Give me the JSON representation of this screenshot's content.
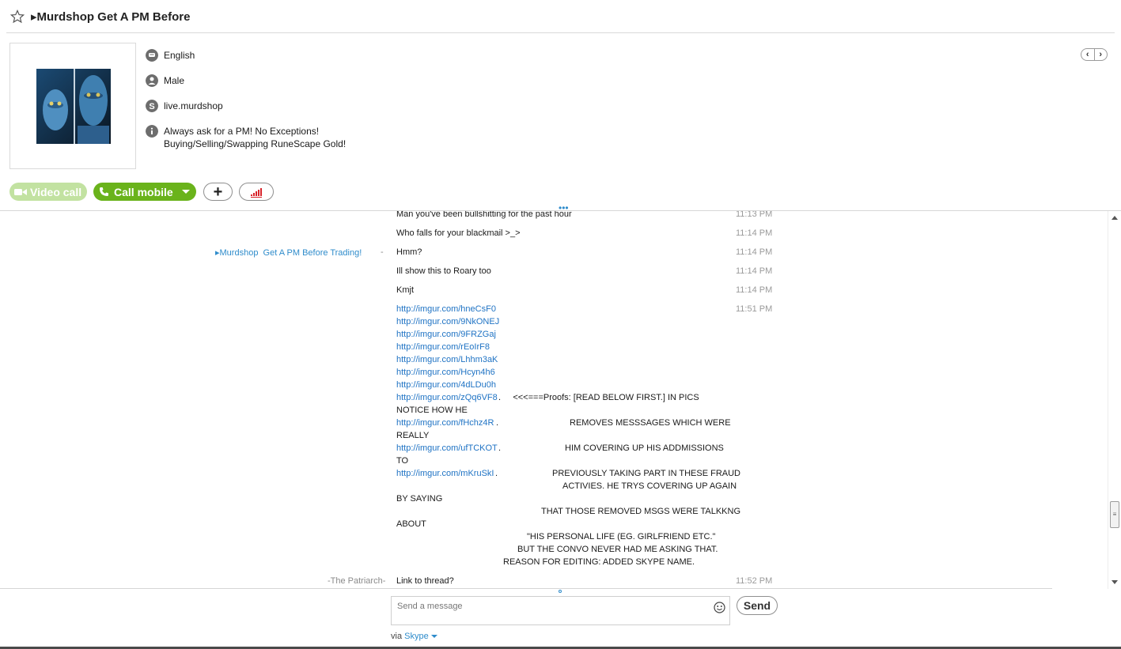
{
  "header": {
    "title": "▸Murdshop  Get A PM Before"
  },
  "profile": {
    "language": "English",
    "gender": "Male",
    "skype_name": "live.murdshop",
    "mood_line1": "Always ask for a PM! No Exceptions!",
    "mood_line2": "Buying/Selling/Swapping RuneScape Gold!"
  },
  "nav": {
    "prev": "‹",
    "next": "›"
  },
  "actions": {
    "video_call": "Video call",
    "call_mobile": "Call mobile",
    "add": "+"
  },
  "chat": {
    "messages": [
      {
        "text": "Man you've been bullshitting for the past hour",
        "time": "11:13 PM"
      },
      {
        "text": "Who falls for your blackmail >_>",
        "time": "11:14 PM"
      },
      {
        "sender": "▸Murdshop  Get A PM Before Trading!",
        "sender_dash": "-",
        "text": "Hmm?",
        "time": "11:14 PM"
      },
      {
        "text": "Ill show this to Roary too",
        "time": "11:14 PM"
      },
      {
        "text": "Kmjt",
        "time": "11:14 PM"
      }
    ],
    "long_message_time": "11:51 PM",
    "links": [
      "http://imgur.com/hneCsF0",
      "http://imgur.com/9NkONEJ",
      "http://imgur.com/9FRZGaj",
      "http://imgur.com/rEoIrF8",
      "http://imgur.com/Lhhm3aK",
      "http://imgur.com/Hcyn4h6",
      "http://imgur.com/4dLDu0h"
    ],
    "proof_link": "http://imgur.com/zQq6VF8",
    "proof_text": ".     <<<===Proofs: [READ BELOW FIRST.] IN PICS",
    "notice": "NOTICE HOW HE",
    "link2": "http://imgur.com/fHchz4R",
    "link2_text": "REMOVES MESSSAGES WHICH WERE",
    "really": "REALLY",
    "link3": "http://imgur.com/ufTCKOT",
    "link3_text": "HIM COVERING UP HIS ADDMISSIONS",
    "to": "TO",
    "link4": "http://imgur.com/mKruSkI",
    "link4_text": "PREVIOUSLY TAKING PART IN THESE FRAUD",
    "activies": "ACTIVIES. HE TRYS COVERING UP AGAIN",
    "by_saying": "BY SAYING",
    "removed_msgs": "THAT THOSE REMOVED MSGS WERE TALKKNG",
    "about": "ABOUT",
    "personal_life": "\"HIS PERSONAL LIFE (EG. GIRLFRIEND ETC.\"",
    "convo": "BUT THE CONVO NEVER HAD ME ASKING THAT.",
    "reason": "REASON FOR EDITING: ADDED SKYPE NAME.",
    "last_sender": "-The Patriarch-",
    "last_text": "Link to thread?",
    "last_time": "11:52 PM"
  },
  "composer": {
    "placeholder": "Send a message",
    "send": "Send",
    "via": "via",
    "via_service": "Skype"
  }
}
